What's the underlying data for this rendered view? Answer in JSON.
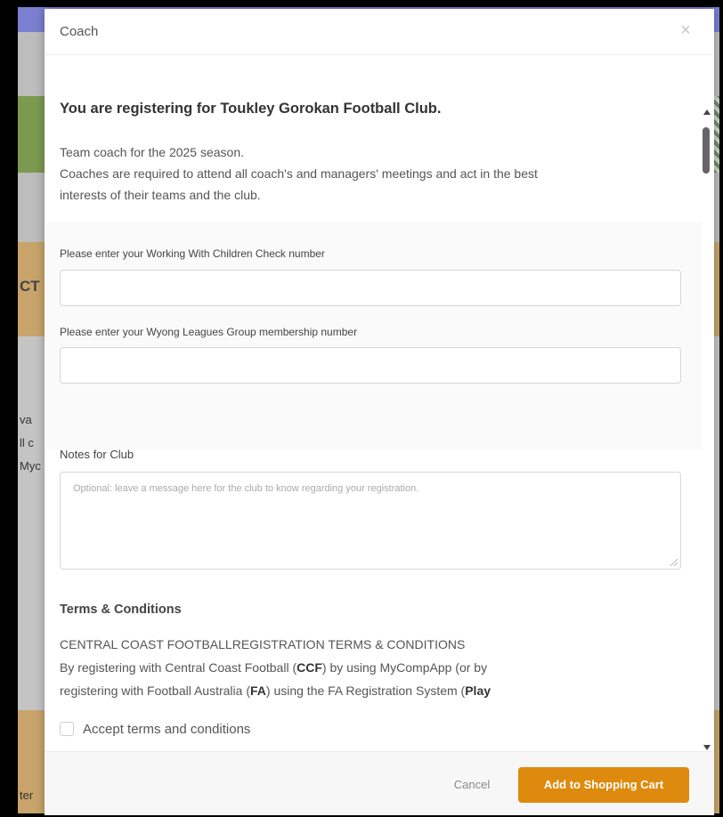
{
  "background": {
    "fragments": [
      "CT",
      "va",
      "ll c",
      "Myc",
      "ter"
    ]
  },
  "modal": {
    "title": "Coach",
    "close_icon": "×",
    "heading": "You are registering for Toukley Gorokan Football Club.",
    "description": [
      "Team coach for the 2025 season.",
      "Coaches are required to attend all coach's and managers' meetings and act in the best",
      "interests of their teams and the club."
    ],
    "fields": {
      "wwcc_label": "Please enter your Working With Children Check number",
      "wwcc_value": "",
      "membership_label": "Please enter your Wyong Leagues Group membership number",
      "membership_value": ""
    },
    "notes": {
      "label": "Notes for Club",
      "placeholder": "Optional: leave a message here for the club to know regarding your registration."
    },
    "terms": {
      "title": "Terms & Conditions",
      "line1": "CENTRAL COAST FOOTBALLREGISTRATION TERMS & CONDITIONS",
      "line2_pre": "By registering with Central Coast Football (",
      "line2_bold": "CCF",
      "line2_post": ") by using MyCompApp (or by",
      "line3_pre": "registering with Football Australia (",
      "line3_bold": "FA",
      "line3_mid": ") using the FA Registration System (",
      "line3_bold2": "Play"
    },
    "accept_label": "Accept terms and conditions",
    "accept_checked": false,
    "footer": {
      "cancel_label": "Cancel",
      "add_label": "Add to Shopping Cart"
    }
  },
  "colors": {
    "accent": "#dd8a0e",
    "header_band": "#7a7fd0"
  }
}
